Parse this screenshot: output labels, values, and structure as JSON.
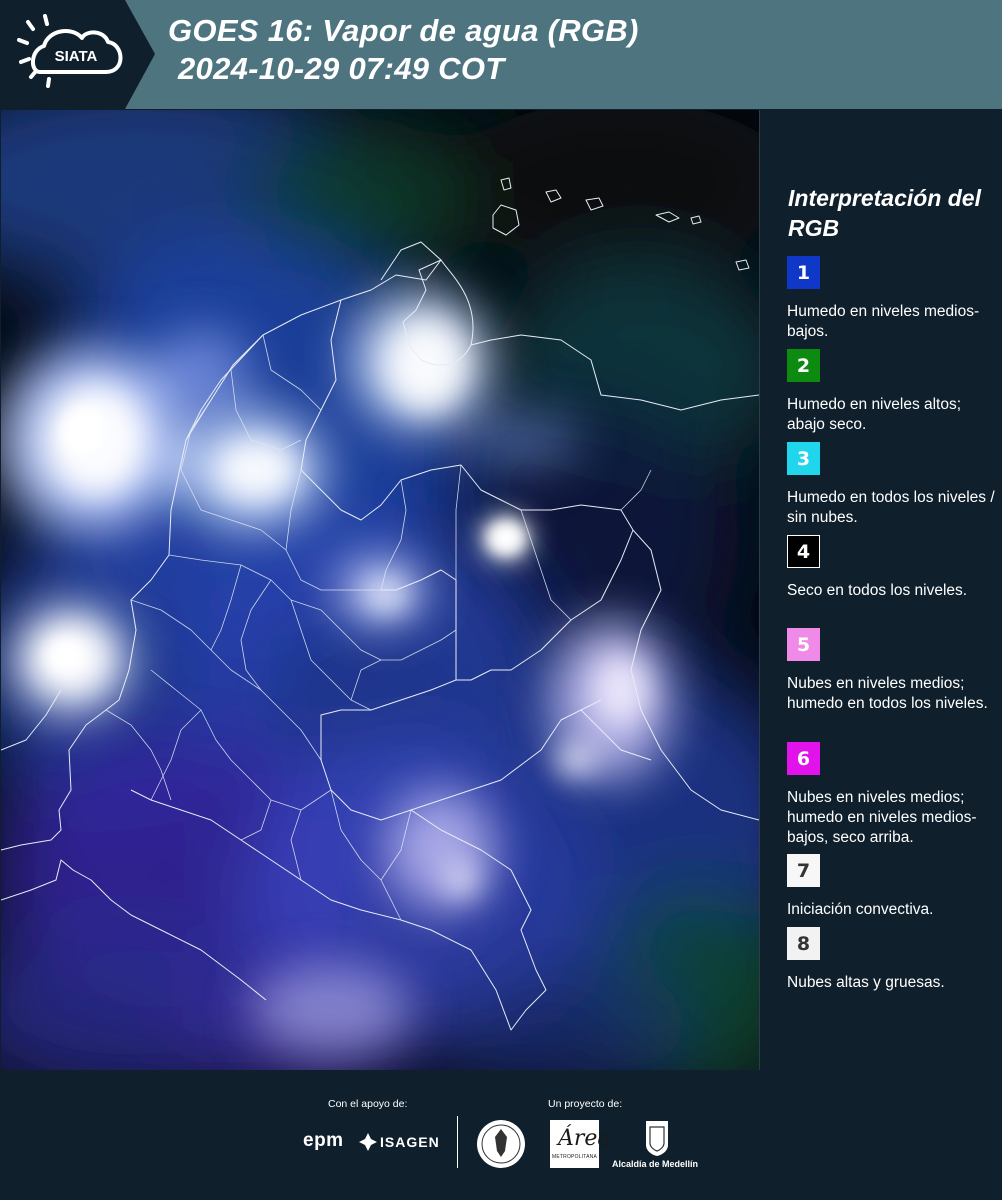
{
  "header": {
    "logo_text": "SIATA",
    "title_line1": "GOES 16: Vapor de agua (RGB)",
    "title_line2": "2024-10-29 07:49 COT"
  },
  "map": {
    "background_color": "#050a12",
    "border_color": "#e6ecf5"
  },
  "legend": {
    "title": "Interpretación del RGB",
    "items": [
      {
        "number": "1",
        "color": "#0f38c9",
        "text_color": "#ffffff",
        "label": "Humedo en niveles medios-bajos."
      },
      {
        "number": "2",
        "color": "#0d8a10",
        "text_color": "#ffffff",
        "label": "Humedo en niveles altos; abajo seco."
      },
      {
        "number": "3",
        "color": "#1fd6ec",
        "text_color": "#ffffff",
        "label": "Humedo en todos los niveles / sin nubes."
      },
      {
        "number": "4",
        "color": "#000000",
        "text_color": "#ffffff",
        "label": "Seco en todos los niveles."
      },
      {
        "number": "5",
        "color": "#f08ae8",
        "text_color": "#ffffff",
        "label": "Nubes en niveles medios; humedo en todos los niveles."
      },
      {
        "number": "6",
        "color": "#e112ea",
        "text_color": "#ffffff",
        "label": "Nubes en niveles medios; humedo en niveles medios-bajos, seco arriba."
      },
      {
        "number": "7",
        "color": "#f7f7f7",
        "text_color": "#333333",
        "label": "Iniciación convectiva."
      },
      {
        "number": "8",
        "color": "#f2f2f2",
        "text_color": "#333333",
        "label": "Nubes altas y gruesas."
      }
    ]
  },
  "footer": {
    "support_label": "Con el apoyo de:",
    "project_label": "Un proyecto de:",
    "sponsor_epm": "epm",
    "sponsor_isagen": "ISAGEN",
    "area_logo_mark": "Área",
    "area_logo_caption": "METROPOLITANA",
    "alcaldia_label": "Alcaldía de Medellín"
  }
}
